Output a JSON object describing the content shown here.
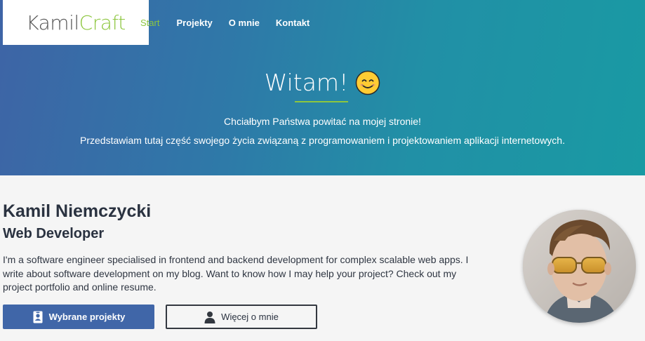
{
  "brand": {
    "part1": "Kamil",
    "part2": "Craft"
  },
  "nav": {
    "items": [
      {
        "label": "Start",
        "active": true
      },
      {
        "label": "Projekty",
        "active": false
      },
      {
        "label": "O mnie",
        "active": false
      },
      {
        "label": "Kontakt",
        "active": false
      }
    ]
  },
  "hero": {
    "title": "Witam!",
    "emoji_icon": "smiling-face-icon",
    "line1": "Chciałbym Państwa powitać na mojej stronie!",
    "line2": "Przedstawiam tutaj część swojego życia związaną z programowaniem i projektowaniem aplikacji internetowych."
  },
  "profile": {
    "name": "Kamil Niemczycki",
    "role": "Web Developer",
    "bio": "I'm a software engineer specialised in frontend and backend development for complex scalable web apps. I write about software development on my blog. Want to know how I may help your project? Check out my project portfolio and online resume."
  },
  "buttons": {
    "projects_label": "Wybrane projekty",
    "projects_icon": "badge-icon",
    "about_label": "Więcej o mnie",
    "about_icon": "user-icon"
  },
  "colors": {
    "accent_green": "#8dc63f",
    "primary_blue": "#4066a8",
    "hero_gradient_start": "#3e64a6",
    "hero_gradient_end": "#199aa3"
  }
}
